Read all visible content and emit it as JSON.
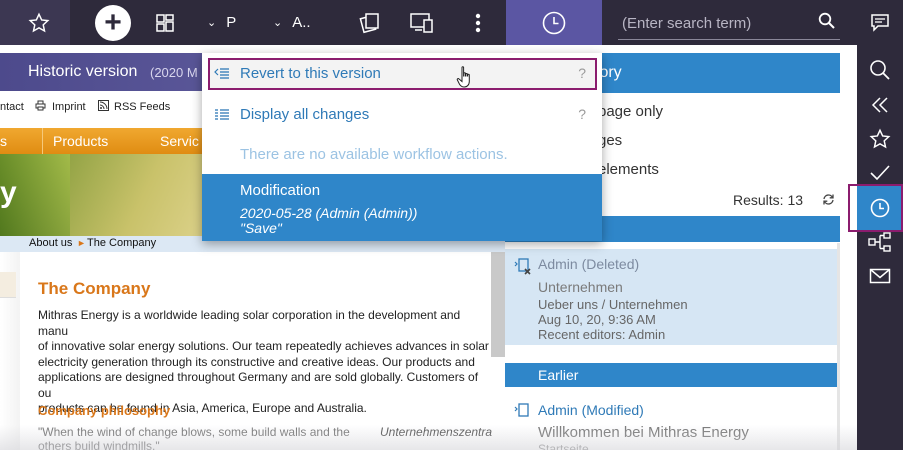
{
  "toolbar": {
    "add_label": "+",
    "dropdown_project": "P",
    "dropdown_language": "A..",
    "search_placeholder": "(Enter search term)"
  },
  "site": {
    "header_title": "Historic version",
    "header_date": "(2020 M",
    "links": [
      "ntact",
      "Imprint",
      "RSS Feeds"
    ],
    "nav": [
      "s",
      "Products",
      "Servic"
    ],
    "banner_letter": "y",
    "breadcrumb": [
      "About us",
      "The Company"
    ],
    "title": "The Company",
    "body": "Mithras Energy is a worldwide leading solar corporation in the development and manu\nof innovative solar energy solutions. Our team repeatedly achieves advances in solar\nelectricity generation through its constructive and creative ideas. Our products and\napplications are designed throughout Germany and are sold globally. Customers of ou\nproducts can be found in Asia, America, Europe and Australia.",
    "subtitle": "Company philosophy",
    "quote": "\"When the wind of change blows, some build walls and the\nothers build windmills.\"",
    "caption": "Unternehmenszentra"
  },
  "menu": {
    "revert_label": "Revert to this version",
    "display_label": "Display all changes",
    "help": "?",
    "no_workflow": "There are no available workflow actions.",
    "modification_title": "Modification",
    "modification_line1": "2020-05-28 (Admin (Admin))",
    "modification_line2": "\"Save\""
  },
  "history": {
    "title": "tory",
    "options": [
      "page only",
      "ges",
      "elements"
    ],
    "results": "Results: 13",
    "selected": {
      "who": "Admin (Deleted)",
      "name": "Unternehmen",
      "path": "Ueber uns / Unternehmen",
      "date": "Aug 10, 20, 9:36 AM",
      "editors": "Recent editors: Admin"
    },
    "earlier_label": "Earlier",
    "next": {
      "who": "Admin (Modified)",
      "name": "Willkommen bei Mithras Energy",
      "path": "Startseite"
    }
  },
  "colors": {
    "toolbar_bg": "#2e2a3b",
    "accent_blue": "#2f86c9",
    "history_purple": "#5b56a3",
    "highlight_border": "#8b1c6e",
    "site_orange": "#d9771a"
  }
}
